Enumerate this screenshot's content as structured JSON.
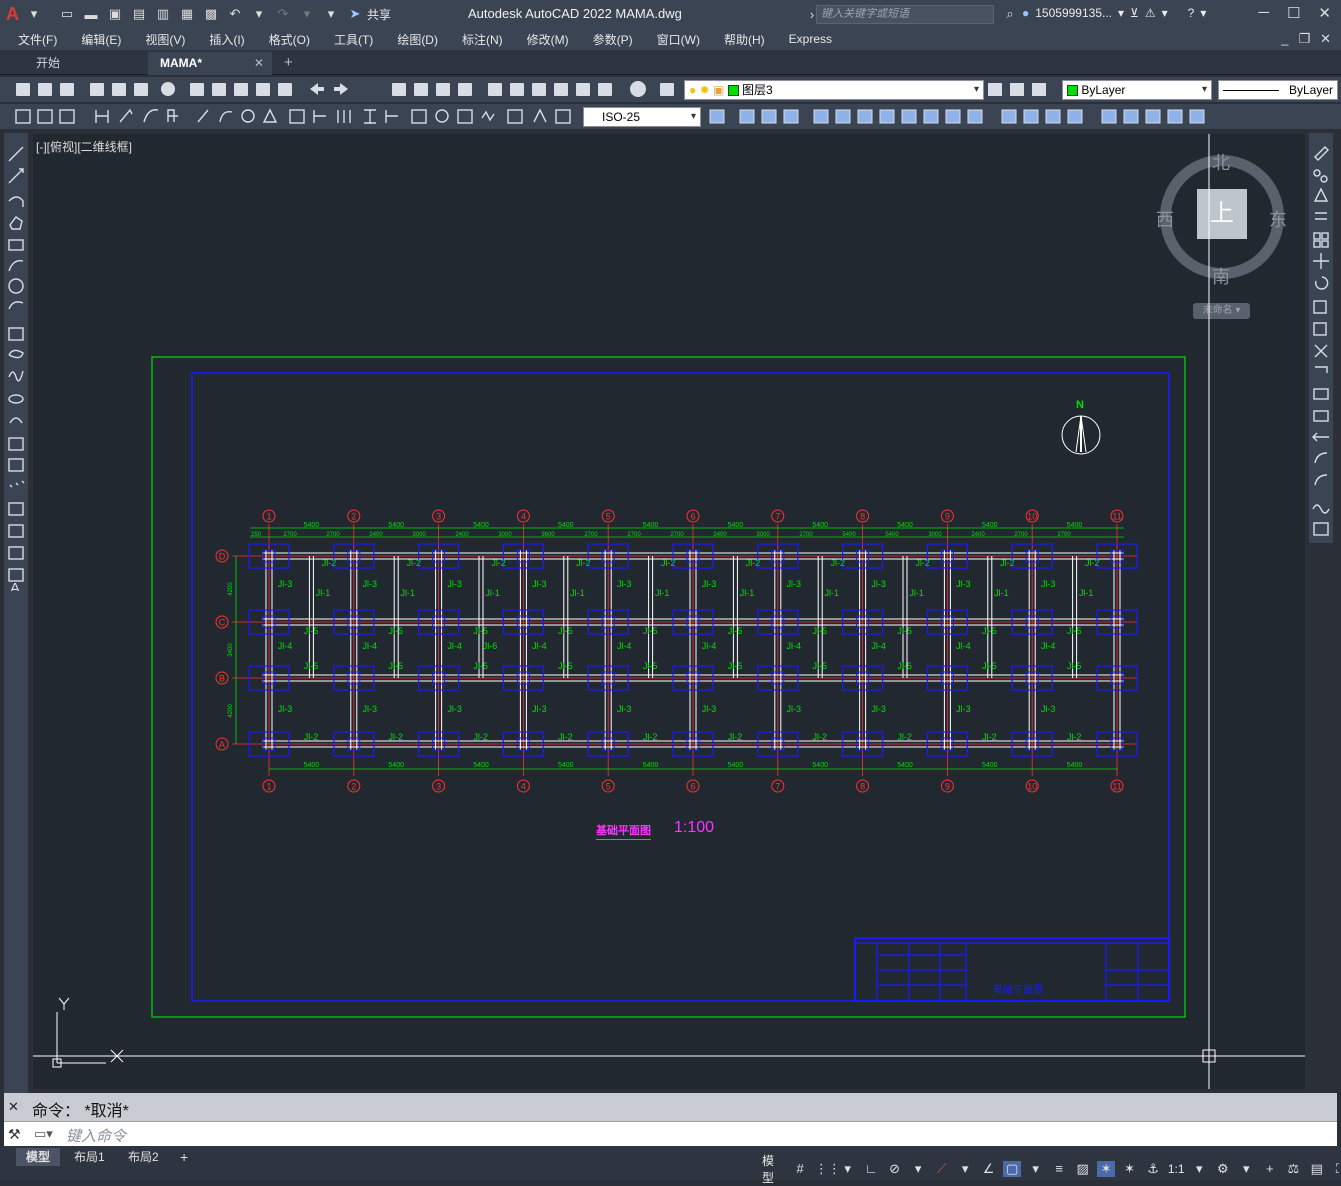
{
  "app": {
    "title": "Autodesk AutoCAD 2022    MAMA.dwg",
    "search_placeholder": "键入关键字或短语",
    "user": "1505999135..."
  },
  "quick_access": {
    "share_label": "共享"
  },
  "menus": [
    "文件(F)",
    "编辑(E)",
    "视图(V)",
    "插入(I)",
    "格式(O)",
    "工具(T)",
    "绘图(D)",
    "标注(N)",
    "修改(M)",
    "参数(P)",
    "窗口(W)",
    "帮助(H)",
    "Express"
  ],
  "tabs": {
    "start": "开始",
    "doc": "MAMA*"
  },
  "layers": {
    "current_layer": "图层3",
    "color": "ByLayer",
    "linetype": "ByLayer",
    "dim_style": "ISO-25"
  },
  "viewport": {
    "label": "[-][俯视][二维线框]"
  },
  "viewcube": {
    "north": "北",
    "south": "南",
    "east": "东",
    "west": "西",
    "face": "上",
    "ucs": "未命名"
  },
  "drawing": {
    "title": "基础平面图",
    "scale": "1:100",
    "north_mark": "N",
    "title_block_name": "基础平面图",
    "grid_columns": [
      "1",
      "2",
      "3",
      "4",
      "5",
      "6",
      "7",
      "8",
      "9",
      "10",
      "11"
    ],
    "grid_rows": [
      "D",
      "C",
      "B",
      "A"
    ],
    "bay_dims_top": [
      "5400",
      "5400",
      "5400",
      "5400",
      "5400",
      "5400",
      "5400",
      "5400",
      "5400",
      "5400"
    ],
    "sub_dims_top": [
      "2700",
      "2700",
      "2400",
      "3000",
      "2400",
      "3000",
      "3600",
      "2700",
      "2700",
      "2700",
      "2400",
      "3000",
      "2700",
      "5400",
      "5400",
      "3000",
      "2400",
      "2700",
      "2700"
    ],
    "row_dims": [
      "4200",
      "3400",
      "4200"
    ],
    "edge_dim": "250",
    "beam_labels": {
      "jl1": "Jl-1",
      "jl2": "Jl-2",
      "jl3": "Jl-3",
      "jl4": "Jl-4",
      "jl5": "Jl-5",
      "jl6": "Jl-6"
    },
    "ucs_x": "X",
    "ucs_y": "Y"
  },
  "command": {
    "history": "命令：  *取消*",
    "placeholder": "键入命令"
  },
  "layouts": [
    "模型",
    "布局1",
    "布局2"
  ],
  "status": {
    "model": "模型",
    "scale": "1:1"
  }
}
